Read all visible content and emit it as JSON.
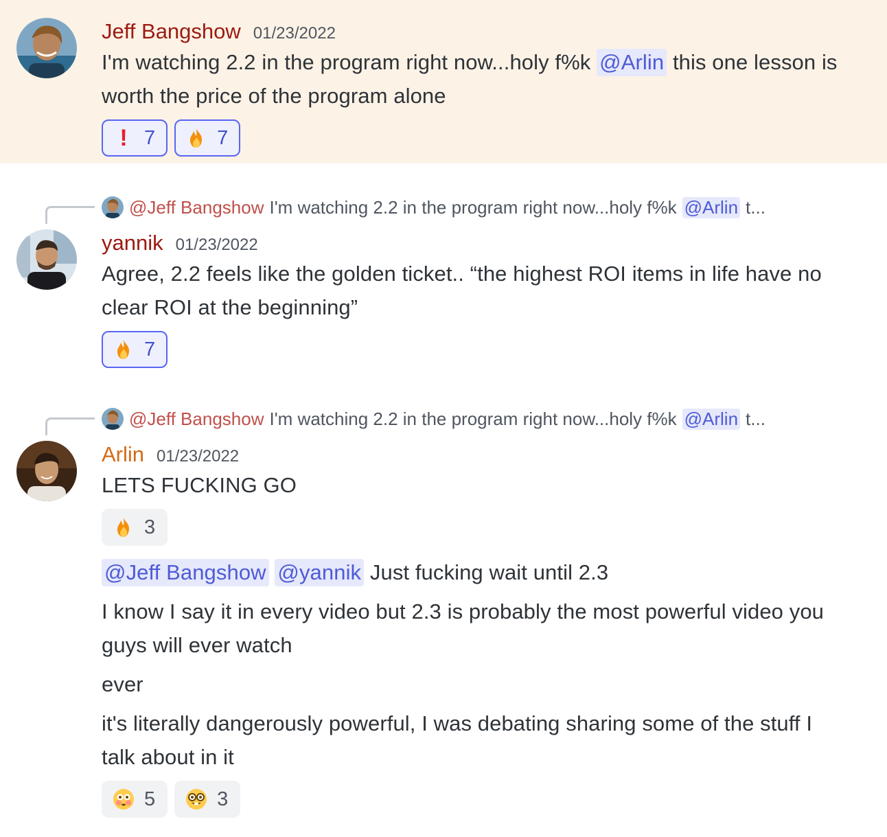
{
  "messages": [
    {
      "author": "Jeff Bangshow",
      "timestamp": "01/23/2022",
      "text_before": "I'm watching 2.2 in the program right now...holy f%k",
      "mention": "@Arlin",
      "text_after": "this one lesson is worth the price of the program alone",
      "reactions": [
        {
          "emoji": "exclamation-mark",
          "glyph": "!",
          "count": "7",
          "active": true
        },
        {
          "emoji": "fire",
          "count": "7",
          "active": true
        }
      ]
    },
    {
      "reply_ref": {
        "author": "@Jeff Bangshow",
        "text": "I'm watching 2.2 in the program right now...holy f%k",
        "mention": "@Arlin",
        "tail": "t..."
      },
      "author": "yannik",
      "timestamp": "01/23/2022",
      "text": "Agree, 2.2 feels like the golden ticket.. “the highest ROI items in life have no clear ROI at the beginning”",
      "reactions": [
        {
          "emoji": "fire",
          "count": "7",
          "active": true
        }
      ]
    },
    {
      "reply_ref": {
        "author": "@Jeff Bangshow",
        "text": "I'm watching 2.2 in the program right now...holy f%k",
        "mention": "@Arlin",
        "tail": "t..."
      },
      "author": "Arlin",
      "timestamp": "01/23/2022",
      "text": "LETS FUCKING GO",
      "reactions": [
        {
          "emoji": "fire",
          "count": "3",
          "active": false
        }
      ],
      "followups": {
        "mention1": "@Jeff Bangshow",
        "mention2": "@yannik",
        "line1": "Just fucking wait until 2.3",
        "line2": "I know I say it in every video but 2.3 is probably the most powerful video you guys will ever watch",
        "line3": "ever",
        "line4": "it's literally dangerously powerful, I was debating sharing some of the stuff I talk about in it"
      },
      "final_reactions": [
        {
          "emoji": "flushed-face",
          "count": "5",
          "active": false
        },
        {
          "emoji": "nerd-face",
          "count": "3",
          "active": false
        }
      ]
    }
  ],
  "colors": {
    "highlight_bg": "#fcf2e6",
    "author_red": "#9c1a10",
    "author_orange": "#d36a16",
    "mention": "#4d5bd6",
    "mention_bg": "#e6e8fb",
    "reaction_active_border": "#5865f2"
  }
}
